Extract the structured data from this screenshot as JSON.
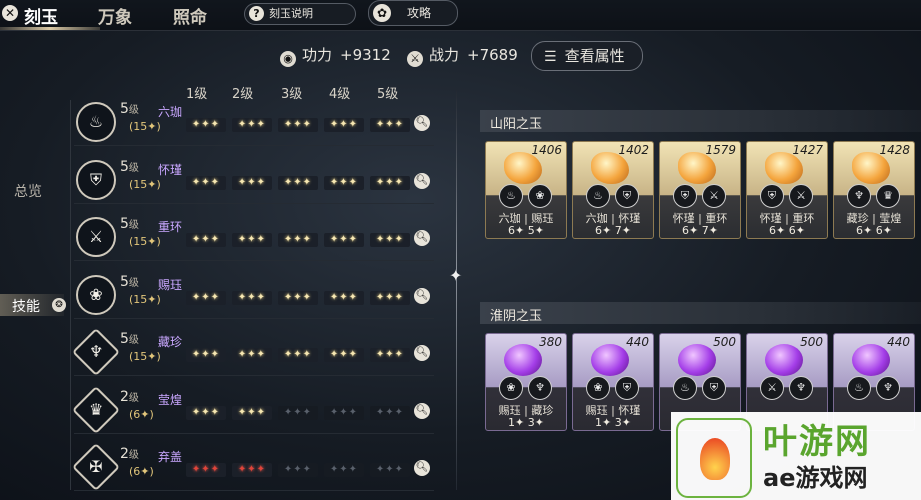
{
  "top_bar": {
    "tabs": [
      {
        "label": "刻玉",
        "active": true
      },
      {
        "label": "万象",
        "active": false
      },
      {
        "label": "照命",
        "active": false
      }
    ],
    "help_label": "刻玉说明",
    "guide_label": "攻略"
  },
  "stats": {
    "gongli_label": "功力",
    "gongli_value": "+9312",
    "zhanli_label": "战力",
    "zhanli_value": "+7689",
    "view_attr_label": "查看属性"
  },
  "level_headers": [
    "1级",
    "2级",
    "3级",
    "4级",
    "5级"
  ],
  "side_nav": {
    "overview": "总览",
    "skill": "技能"
  },
  "skills": [
    {
      "level": "5",
      "level_suffix": "级",
      "name": "六珈",
      "points": "(15✦)",
      "pips": [
        "✦✦✦",
        "✦✦✦",
        "✦✦✦",
        "✦✦✦",
        "✦✦✦"
      ],
      "filled": 5,
      "color": "gold",
      "icon": "cup-icon"
    },
    {
      "level": "5",
      "level_suffix": "级",
      "name": "怀瑾",
      "points": "(15✦)",
      "pips": [
        "✦✦✦",
        "✦✦✦",
        "✦✦✦",
        "✦✦✦",
        "✦✦✦"
      ],
      "filled": 5,
      "color": "gold",
      "icon": "shield-icon"
    },
    {
      "level": "5",
      "level_suffix": "级",
      "name": "重环",
      "points": "(15✦)",
      "pips": [
        "✦✦✦",
        "✦✦✦",
        "✦✦✦",
        "✦✦✦",
        "✦✦✦"
      ],
      "filled": 5,
      "color": "gold",
      "icon": "sword-icon"
    },
    {
      "level": "5",
      "level_suffix": "级",
      "name": "赐珏",
      "points": "(15✦)",
      "pips": [
        "✦✦✦",
        "✦✦✦",
        "✦✦✦",
        "✦✦✦",
        "✦✦✦"
      ],
      "filled": 5,
      "color": "gold",
      "icon": "lotus-icon"
    },
    {
      "level": "5",
      "level_suffix": "级",
      "name": "藏珍",
      "points": "(15✦)",
      "pips": [
        "✦✦✦",
        "✦✦✦",
        "✦✦✦",
        "✦✦✦",
        "✦✦✦"
      ],
      "filled": 5,
      "color": "gold",
      "icon": "phoenix-icon"
    },
    {
      "level": "2",
      "level_suffix": "级",
      "name": "莹煌",
      "points": "(6✦)",
      "pips": [
        "✦✦✦",
        "✦✦✦",
        "✦✦✦",
        "✦✦✦",
        "✦✦✦"
      ],
      "filled": 2,
      "color": "gold",
      "icon": "crest-icon"
    },
    {
      "level": "2",
      "level_suffix": "级",
      "name": "弃盖",
      "points": "(6✦)",
      "pips": [
        "✦✦✦",
        "✦✦✦",
        "✦✦✦",
        "✦✦✦",
        "✦✦✦"
      ],
      "filled": 2,
      "color": "red",
      "icon": "blade-icon"
    }
  ],
  "sections": [
    {
      "title": "山阳之玉",
      "type": "gold",
      "jades": [
        {
          "value": "1406",
          "names": "六珈 | 赐珏",
          "nums": "6✦  5✦",
          "i1": "cup-icon",
          "i2": "lotus-icon"
        },
        {
          "value": "1402",
          "names": "六珈 | 怀瑾",
          "nums": "6✦  7✦",
          "i1": "cup-icon",
          "i2": "shield-icon"
        },
        {
          "value": "1579",
          "names": "怀瑾 | 重环",
          "nums": "6✦  7✦",
          "i1": "shield-icon",
          "i2": "sword-icon"
        },
        {
          "value": "1427",
          "names": "怀瑾 | 重环",
          "nums": "6✦  6✦",
          "i1": "shield-icon",
          "i2": "sword-icon"
        },
        {
          "value": "1428",
          "names": "藏珍 | 莹煌",
          "nums": "6✦  6✦",
          "i1": "phoenix-icon",
          "i2": "crest-icon"
        }
      ]
    },
    {
      "title": "淮阴之玉",
      "type": "purple",
      "jades": [
        {
          "value": "380",
          "names": "赐珏 | 藏珍",
          "nums": "1✦  3✦",
          "i1": "lotus-icon",
          "i2": "phoenix-icon"
        },
        {
          "value": "440",
          "names": "赐珏 | 怀瑾",
          "nums": "1✦  3✦",
          "i1": "lotus-icon",
          "i2": "shield-icon"
        },
        {
          "value": "500",
          "names": "",
          "nums": "",
          "i1": "cup-icon",
          "i2": "shield-icon"
        },
        {
          "value": "500",
          "names": "",
          "nums": "",
          "i1": "sword-icon",
          "i2": "phoenix-icon"
        },
        {
          "value": "440",
          "names": "",
          "nums": "",
          "i1": "cup-icon",
          "i2": "phoenix-icon"
        }
      ]
    }
  ],
  "watermark": {
    "big": "叶游网",
    "small": "ae游戏网"
  }
}
